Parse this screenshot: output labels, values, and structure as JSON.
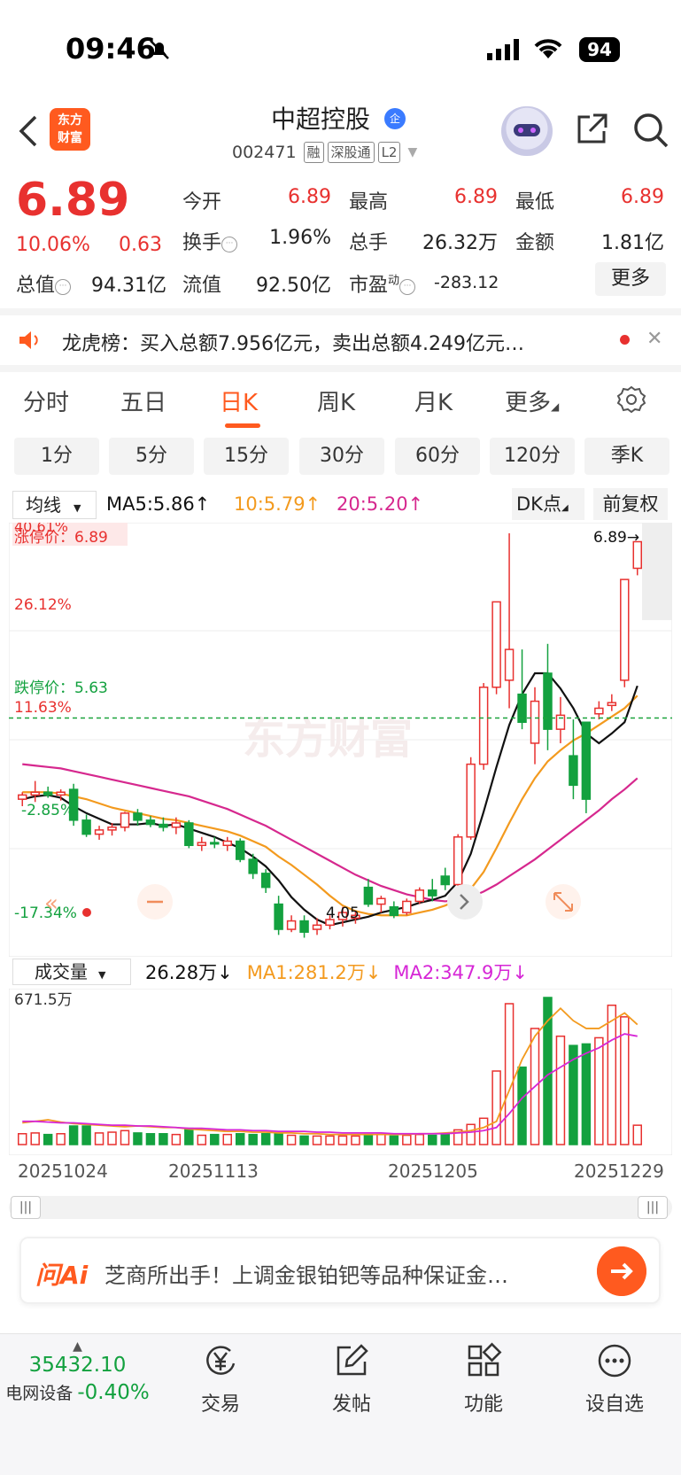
{
  "status_bar": {
    "time": "09:46",
    "battery": "94"
  },
  "header": {
    "logo_line1": "东方",
    "logo_line2": "财富",
    "stock_name": "中超控股",
    "verify_badge": "企",
    "stock_code": "002471",
    "tags": [
      "融",
      "深股通",
      "L2"
    ]
  },
  "quote": {
    "price": "6.89",
    "change_pct": "10.06%",
    "change": "0.63",
    "fields": [
      {
        "label": "今开",
        "value": "6.89",
        "color": "red"
      },
      {
        "label": "最高",
        "value": "6.89",
        "color": "red"
      },
      {
        "label": "最低",
        "value": "6.89",
        "color": "red"
      },
      {
        "label": "换手",
        "value": "1.96%",
        "color": "black"
      },
      {
        "label": "总手",
        "value": "26.32万",
        "color": "black"
      },
      {
        "label": "金额",
        "value": "1.81亿",
        "color": "black"
      },
      {
        "label": "总值",
        "value": "94.31亿",
        "color": "black"
      },
      {
        "label": "流值",
        "value": "92.50亿",
        "color": "black"
      },
      {
        "label": "市盈",
        "label_sup": "动",
        "value": "-283.12",
        "color": "black"
      }
    ],
    "more_label": "更多"
  },
  "news": {
    "text": "龙虎榜：买入总额7.956亿元，卖出总额4.249亿元…"
  },
  "period_tabs": [
    "分时",
    "五日",
    "日K",
    "周K",
    "月K",
    "更多"
  ],
  "active_period": "日K",
  "minute_tabs": [
    "1分",
    "5分",
    "15分",
    "30分",
    "60分",
    "120分",
    "季K"
  ],
  "indicator": {
    "select": "均线",
    "ma5": "MA5:5.86↑",
    "ma10": "10:5.79↑",
    "ma20": "20:5.20↑",
    "dk_label": "DK点",
    "fq_label": "前复权"
  },
  "colors": {
    "up": "#e8312f",
    "down": "#13a13f",
    "ma5": "#111111",
    "ma10": "#f39a1e",
    "ma20": "#d6288e",
    "accent": "#ff5a1f"
  },
  "chart_labels": {
    "top_pct": "40.61%",
    "limit_up": "涨停价：6.89",
    "pct_26": "26.12%",
    "limit_down": "跌停价：5.63",
    "pct_11": "11.63%",
    "pct_2": "-2.85%",
    "pct_neg17": "-17.34%",
    "last_price": "6.89→",
    "low_price": "4.05",
    "watermark": "东方财富"
  },
  "volume": {
    "select": "成交量",
    "current": "26.28万↓",
    "ma1": "MA1:281.2万↓",
    "ma2": "MA2:347.9万↓",
    "max_label": "671.5万"
  },
  "dates": [
    "20251024",
    "20251113",
    "20251205",
    "20251229"
  ],
  "chart_data": {
    "type": "candlestick",
    "ylim": [
      4.0,
      6.95
    ],
    "candles": [
      [
        5.05,
        5.1,
        5.0,
        5.08
      ],
      [
        5.08,
        5.18,
        5.03,
        5.1
      ],
      [
        5.1,
        5.14,
        5.06,
        5.08
      ],
      [
        5.08,
        5.12,
        5.04,
        5.1
      ],
      [
        5.12,
        5.16,
        4.86,
        4.9
      ],
      [
        4.9,
        4.94,
        4.78,
        4.8
      ],
      [
        4.8,
        4.86,
        4.76,
        4.83
      ],
      [
        4.83,
        4.88,
        4.79,
        4.85
      ],
      [
        4.85,
        4.96,
        4.82,
        4.95
      ],
      [
        4.95,
        4.98,
        4.86,
        4.9
      ],
      [
        4.9,
        4.93,
        4.85,
        4.87
      ],
      [
        4.87,
        4.92,
        4.82,
        4.85
      ],
      [
        4.85,
        4.92,
        4.8,
        4.88
      ],
      [
        4.88,
        4.9,
        4.7,
        4.72
      ],
      [
        4.72,
        4.78,
        4.68,
        4.74
      ],
      [
        4.74,
        4.78,
        4.7,
        4.73
      ],
      [
        4.72,
        4.78,
        4.68,
        4.75
      ],
      [
        4.75,
        4.77,
        4.6,
        4.62
      ],
      [
        4.62,
        4.66,
        4.48,
        4.52
      ],
      [
        4.52,
        4.55,
        4.38,
        4.42
      ],
      [
        4.3,
        4.36,
        4.08,
        4.12
      ],
      [
        4.12,
        4.22,
        4.1,
        4.18
      ],
      [
        4.18,
        4.22,
        4.06,
        4.1
      ],
      [
        4.12,
        4.2,
        4.08,
        4.15
      ],
      [
        4.15,
        4.22,
        4.12,
        4.19
      ],
      [
        4.19,
        4.28,
        4.14,
        4.24
      ],
      [
        4.2,
        4.25,
        4.16,
        4.22
      ],
      [
        4.42,
        4.48,
        4.28,
        4.3
      ],
      [
        4.3,
        4.36,
        4.24,
        4.34
      ],
      [
        4.28,
        4.32,
        4.2,
        4.22
      ],
      [
        4.24,
        4.34,
        4.22,
        4.32
      ],
      [
        4.32,
        4.42,
        4.3,
        4.4
      ],
      [
        4.4,
        4.48,
        4.32,
        4.36
      ],
      [
        4.5,
        4.56,
        4.4,
        4.44
      ],
      [
        4.44,
        4.8,
        4.42,
        4.78
      ],
      [
        4.78,
        5.35,
        4.76,
        5.3
      ],
      [
        5.3,
        5.88,
        5.26,
        5.85
      ],
      [
        5.85,
        6.46,
        5.8,
        6.46
      ],
      [
        5.9,
        6.95,
        5.7,
        6.12
      ],
      [
        5.8,
        6.12,
        5.55,
        5.6
      ],
      [
        5.45,
        5.85,
        5.3,
        5.75
      ],
      [
        5.95,
        6.16,
        5.4,
        5.55
      ],
      [
        5.55,
        5.78,
        5.45,
        5.65
      ],
      [
        5.36,
        5.62,
        5.05,
        5.15
      ],
      [
        5.6,
        5.6,
        4.95,
        5.05
      ],
      [
        5.66,
        5.75,
        5.62,
        5.7
      ],
      [
        5.72,
        5.8,
        5.68,
        5.74
      ],
      [
        5.9,
        6.62,
        5.85,
        6.62
      ],
      [
        6.7,
        6.89,
        6.65,
        6.89
      ]
    ],
    "ma5": [
      5.05,
      5.07,
      5.08,
      5.06,
      5.0,
      4.95,
      4.91,
      4.87,
      4.87,
      4.87,
      4.88,
      4.86,
      4.87,
      4.84,
      4.81,
      4.78,
      4.74,
      4.7,
      4.64,
      4.57,
      4.47,
      4.35,
      4.26,
      4.19,
      4.15,
      4.17,
      4.19,
      4.21,
      4.24,
      4.26,
      4.28,
      4.31,
      4.33,
      4.36,
      4.46,
      4.66,
      4.96,
      5.28,
      5.58,
      5.8,
      5.95,
      5.95,
      5.84,
      5.7,
      5.52,
      5.45,
      5.52,
      5.6,
      5.86
    ],
    "ma10": [
      5.1,
      5.1,
      5.1,
      5.09,
      5.07,
      5.05,
      5.02,
      4.99,
      4.97,
      4.95,
      4.93,
      4.91,
      4.9,
      4.88,
      4.86,
      4.84,
      4.82,
      4.79,
      4.75,
      4.71,
      4.64,
      4.58,
      4.51,
      4.44,
      4.36,
      4.29,
      4.25,
      4.23,
      4.22,
      4.22,
      4.22,
      4.24,
      4.26,
      4.29,
      4.33,
      4.41,
      4.53,
      4.7,
      4.88,
      5.05,
      5.2,
      5.32,
      5.4,
      5.47,
      5.52,
      5.58,
      5.64,
      5.7,
      5.79
    ],
    "ma20": [
      5.3,
      5.29,
      5.28,
      5.27,
      5.25,
      5.23,
      5.21,
      5.19,
      5.17,
      5.15,
      5.13,
      5.11,
      5.09,
      5.07,
      5.04,
      5.01,
      4.98,
      4.94,
      4.9,
      4.86,
      4.81,
      4.76,
      4.71,
      4.66,
      4.61,
      4.56,
      4.51,
      4.47,
      4.43,
      4.4,
      4.37,
      4.35,
      4.33,
      4.32,
      4.33,
      4.35,
      4.39,
      4.44,
      4.5,
      4.56,
      4.62,
      4.69,
      4.76,
      4.83,
      4.9,
      4.97,
      5.05,
      5.12,
      5.2
    ],
    "volume": [
      14,
      15,
      13,
      14,
      24,
      24,
      15,
      16,
      18,
      15,
      14,
      14,
      13,
      21,
      12,
      13,
      13,
      14,
      13,
      14,
      14,
      12,
      11,
      11,
      11,
      11,
      11,
      13,
      13,
      11,
      12,
      13,
      12,
      14,
      19,
      26,
      34,
      95,
      182,
      100,
      150,
      190,
      140,
      128,
      130,
      138,
      180,
      165,
      25
    ],
    "vol_ma1": [
      28,
      30,
      32,
      29,
      27,
      26,
      25,
      24,
      23,
      24,
      23,
      22,
      22,
      20,
      19,
      18,
      17,
      17,
      16,
      16,
      15,
      15,
      14,
      14,
      13,
      13,
      13,
      13,
      13,
      13,
      13,
      14,
      14,
      15,
      16,
      18,
      22,
      30,
      70,
      110,
      140,
      160,
      176,
      160,
      150,
      150,
      160,
      170,
      155
    ],
    "vol_ma2": [
      30,
      30,
      29,
      28,
      28,
      27,
      26,
      25,
      25,
      24,
      24,
      23,
      22,
      21,
      21,
      20,
      19,
      19,
      18,
      18,
      17,
      17,
      17,
      16,
      16,
      15,
      15,
      15,
      15,
      14,
      14,
      14,
      14,
      14,
      15,
      16,
      18,
      22,
      40,
      60,
      75,
      90,
      100,
      110,
      118,
      125,
      135,
      143,
      140
    ]
  },
  "ai_box": {
    "logo": "问Ai",
    "text": "芝商所出手！上调金银铂钯等品种保证金…"
  },
  "bottom_nav": {
    "index_value": "35432.10",
    "index_name": "电网设备",
    "index_change": "-0.40%",
    "items": [
      {
        "label": "交易",
        "icon": "yen-icon"
      },
      {
        "label": "发帖",
        "icon": "edit-icon"
      },
      {
        "label": "功能",
        "icon": "grid-icon"
      },
      {
        "label": "设自选",
        "icon": "more-icon"
      }
    ]
  }
}
